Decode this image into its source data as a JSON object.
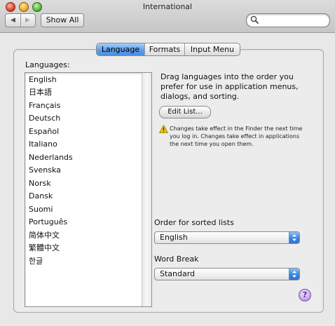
{
  "window": {
    "title": "International"
  },
  "toolbar": {
    "back_glyph": "◀",
    "forward_glyph": "▶",
    "show_all_label": "Show All",
    "search_placeholder": ""
  },
  "tabs": [
    {
      "label": "Language",
      "selected": true
    },
    {
      "label": "Formats",
      "selected": false
    },
    {
      "label": "Input Menu",
      "selected": false
    }
  ],
  "languages": {
    "label": "Languages:",
    "items": [
      "English",
      "日本語",
      "Français",
      "Deutsch",
      "Español",
      "Italiano",
      "Nederlands",
      "Svenska",
      "Norsk",
      "Dansk",
      "Suomi",
      "Português",
      "简体中文",
      "繁體中文",
      "한글"
    ]
  },
  "instructions": "Drag languages into the order you prefer for use in application menus, dialogs, and sorting.",
  "edit_list_label": "Edit List...",
  "warning_text": "Changes take effect in the Finder the next time you log in. Changes take effect in applications the next time you open them.",
  "sort_order": {
    "label": "Order for sorted lists",
    "value": "English"
  },
  "word_break": {
    "label": "Word Break",
    "value": "Standard"
  },
  "help_label": "?",
  "colors": {
    "accent": "#4b8fe0",
    "warning": "#f2c21a",
    "help": "#9b73d4"
  }
}
